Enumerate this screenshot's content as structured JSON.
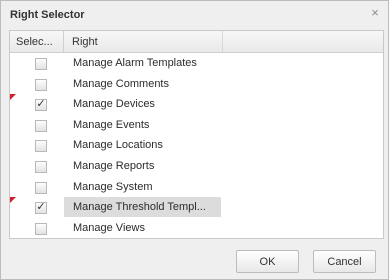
{
  "dialog": {
    "title": "Right Selector",
    "close_glyph": "×"
  },
  "grid": {
    "columns": [
      "Selec...",
      "Right"
    ],
    "rows": [
      {
        "label": "Manage Alarm Templates",
        "checked": false,
        "dirty": false,
        "highlight": false
      },
      {
        "label": "Manage Comments",
        "checked": false,
        "dirty": false,
        "highlight": false
      },
      {
        "label": "Manage Devices",
        "checked": true,
        "dirty": true,
        "highlight": false
      },
      {
        "label": "Manage Events",
        "checked": false,
        "dirty": false,
        "highlight": false
      },
      {
        "label": "Manage Locations",
        "checked": false,
        "dirty": false,
        "highlight": false
      },
      {
        "label": "Manage Reports",
        "checked": false,
        "dirty": false,
        "highlight": false
      },
      {
        "label": "Manage System",
        "checked": false,
        "dirty": false,
        "highlight": false
      },
      {
        "label": "Manage Threshold Templ...",
        "checked": true,
        "dirty": true,
        "highlight": true
      },
      {
        "label": "Manage Views",
        "checked": false,
        "dirty": false,
        "highlight": false
      }
    ]
  },
  "buttons": {
    "ok": "OK",
    "cancel": "Cancel"
  },
  "colors": {
    "dirty_marker": "#d0202e",
    "highlight_row": "#dcdcdc"
  },
  "icons": {
    "close": "close-icon",
    "check": "checkmark-icon",
    "dirty": "dirty-marker-icon"
  }
}
